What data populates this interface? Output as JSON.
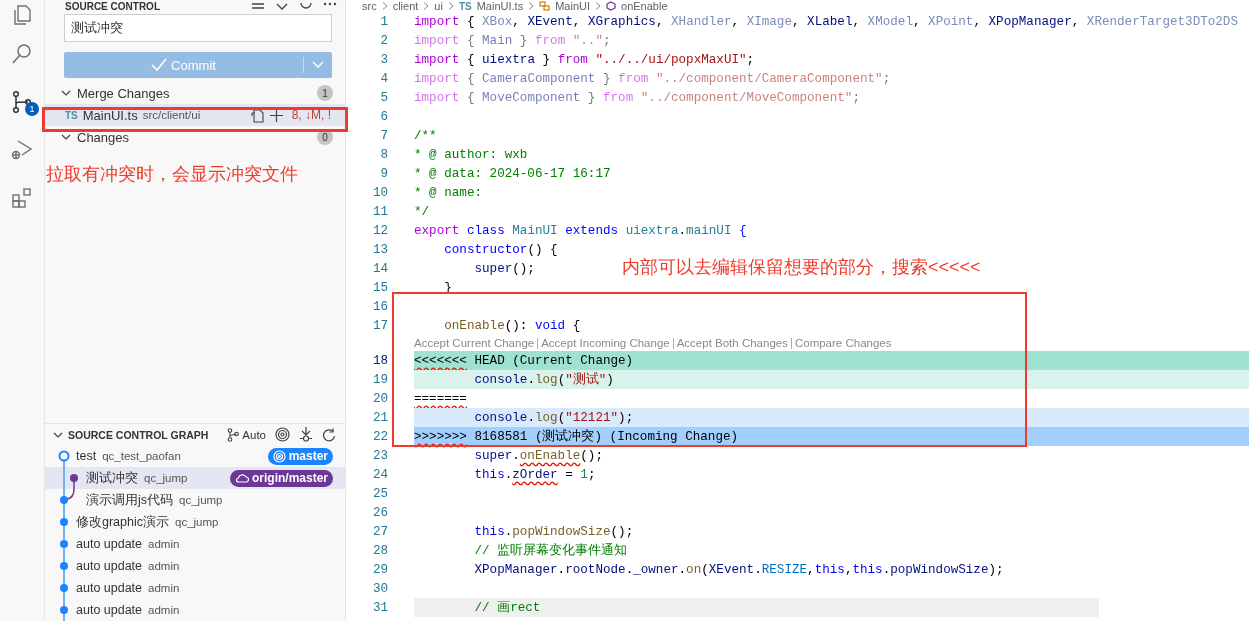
{
  "activity_bar": [
    {
      "kind": "explorer",
      "selected": false
    },
    {
      "kind": "search",
      "selected": false
    },
    {
      "kind": "source-control",
      "selected": true,
      "badge": "1"
    },
    {
      "kind": "run-debug",
      "selected": false
    },
    {
      "kind": "extensions",
      "selected": false
    }
  ],
  "sidebar": {
    "title": "SOURCE CONTROL",
    "commit_message": "测试冲突",
    "commit_button": "Commit",
    "groups": [
      {
        "label": "Merge Changes",
        "count": "1",
        "expanded": true,
        "files": [
          {
            "badge": "TS",
            "name": "MainUI.ts",
            "path": "src/client/ui",
            "status": "8, ↓M, !",
            "selected": true
          }
        ]
      },
      {
        "label": "Changes",
        "count": "0",
        "expanded": true
      }
    ],
    "note": "拉取有冲突时，会显示冲突文件",
    "graph": {
      "title": "SOURCE CONTROL GRAPH",
      "mode": "Auto",
      "commits": [
        {
          "kind": "head",
          "message": "test",
          "author": "qc_test_paofan",
          "selected": false,
          "ref": {
            "kind": "local",
            "label": "master"
          }
        },
        {
          "kind": "branch",
          "message": "测试冲突",
          "author": "qc_jump",
          "selected": true,
          "ref": {
            "kind": "remote",
            "label": "origin/master"
          }
        },
        {
          "kind": "join",
          "message": "演示调用js代码",
          "author": "qc_jump",
          "selected": false
        },
        {
          "kind": "commit",
          "message": "修改graphic演示",
          "author": "qc_jump",
          "selected": false
        },
        {
          "kind": "commit",
          "message": "auto update",
          "author": "admin",
          "selected": false
        },
        {
          "kind": "commit",
          "message": "auto update",
          "author": "admin",
          "selected": false
        },
        {
          "kind": "commit",
          "message": "auto update",
          "author": "admin",
          "selected": false
        },
        {
          "kind": "commit",
          "message": "auto update",
          "author": "admin",
          "selected": false
        }
      ]
    }
  },
  "editor": {
    "breadcrumb": {
      "folders": [
        "src",
        "client",
        "ui"
      ],
      "file_badge": "TS",
      "file": "MainUI.ts",
      "class": "MainUI",
      "method": "onEnable"
    },
    "codelens": [
      "Accept Current Change",
      "Accept Incoming Change",
      "Accept Both Changes",
      "Compare Changes"
    ],
    "note": "内部可以去编辑保留想要的部分，搜索<<<<<",
    "lines": [
      {
        "n": "1",
        "kind": "code",
        "tokens": [
          {
            "text": "import ",
            "kind": "kw"
          },
          {
            "text": "{ ",
            "kind": "p"
          },
          {
            "text": "XBox",
            "kind": "u"
          },
          {
            "text": ", ",
            "kind": "p"
          },
          {
            "text": "XEvent",
            "kind": "v"
          },
          {
            "text": ", ",
            "kind": "p"
          },
          {
            "text": "XGraphics",
            "kind": "v"
          },
          {
            "text": ", ",
            "kind": "p"
          },
          {
            "text": "XHandler",
            "kind": "u"
          },
          {
            "text": ", ",
            "kind": "p"
          },
          {
            "text": "XImage",
            "kind": "u"
          },
          {
            "text": ", ",
            "kind": "p"
          },
          {
            "text": "XLabel",
            "kind": "v"
          },
          {
            "text": ", ",
            "kind": "p"
          },
          {
            "text": "XModel",
            "kind": "u"
          },
          {
            "text": ", ",
            "kind": "p"
          },
          {
            "text": "XPoint",
            "kind": "u"
          },
          {
            "text": ", ",
            "kind": "p"
          },
          {
            "text": "XPopManager",
            "kind": "v"
          },
          {
            "text": ", ",
            "kind": "p"
          },
          {
            "text": "XRenderTarget3DTo2DS",
            "kind": "u"
          }
        ]
      },
      {
        "n": "2",
        "kind": "faded",
        "tokens": [
          {
            "text": "import ",
            "kind": "kw"
          },
          {
            "text": "{ ",
            "kind": "p"
          },
          {
            "text": "Main",
            "kind": "v"
          },
          {
            "text": " } ",
            "kind": "p"
          },
          {
            "text": "from ",
            "kind": "kw"
          },
          {
            "text": "\"..\"",
            "kind": "str"
          },
          {
            "text": ";",
            "kind": "p"
          }
        ]
      },
      {
        "n": "3",
        "kind": "code",
        "tokens": [
          {
            "text": "import ",
            "kind": "kw"
          },
          {
            "text": "{ ",
            "kind": "p"
          },
          {
            "text": "uiextra",
            "kind": "v"
          },
          {
            "text": " } ",
            "kind": "p"
          },
          {
            "text": "from ",
            "kind": "kw"
          },
          {
            "text": "\"../../ui/popxMaxUI\"",
            "kind": "str"
          },
          {
            "text": ";",
            "kind": "p"
          }
        ]
      },
      {
        "n": "4",
        "kind": "faded",
        "tokens": [
          {
            "text": "import ",
            "kind": "kw"
          },
          {
            "text": "{ ",
            "kind": "p"
          },
          {
            "text": "CameraComponent",
            "kind": "v"
          },
          {
            "text": " } ",
            "kind": "p"
          },
          {
            "text": "from ",
            "kind": "kw"
          },
          {
            "text": "\"../component/CameraComponent\"",
            "kind": "str"
          },
          {
            "text": ";",
            "kind": "p"
          }
        ]
      },
      {
        "n": "5",
        "kind": "faded",
        "tokens": [
          {
            "text": "import ",
            "kind": "kw"
          },
          {
            "text": "{ ",
            "kind": "p"
          },
          {
            "text": "MoveComponent",
            "kind": "v"
          },
          {
            "text": " } ",
            "kind": "p"
          },
          {
            "text": "from ",
            "kind": "kw"
          },
          {
            "text": "\"../component/MoveComponent\"",
            "kind": "str"
          },
          {
            "text": ";",
            "kind": "p"
          }
        ]
      },
      {
        "n": "6",
        "kind": "code"
      },
      {
        "n": "7",
        "kind": "code",
        "tokens": [
          {
            "text": "/**",
            "kind": "c"
          }
        ]
      },
      {
        "n": "8",
        "kind": "code",
        "tokens": [
          {
            "text": "* @ author: wxb",
            "kind": "c"
          }
        ]
      },
      {
        "n": "9",
        "kind": "code",
        "tokens": [
          {
            "text": "* @ data: 2024-06-17 16:17",
            "kind": "c"
          }
        ]
      },
      {
        "n": "10",
        "kind": "code",
        "tokens": [
          {
            "text": "* @ name:",
            "kind": "c"
          }
        ]
      },
      {
        "n": "11",
        "kind": "code",
        "tokens": [
          {
            "text": "*/",
            "kind": "c"
          }
        ]
      },
      {
        "n": "12",
        "kind": "code",
        "tokens": [
          {
            "text": "export ",
            "kind": "kw"
          },
          {
            "text": "class ",
            "kind": "st"
          },
          {
            "text": "MainUI ",
            "kind": "ty"
          },
          {
            "text": "extends ",
            "kind": "st"
          },
          {
            "text": "uiextra",
            "kind": "ty"
          },
          {
            "text": ".",
            "kind": "p"
          },
          {
            "text": "mainUI ",
            "kind": "ty"
          },
          {
            "text": "{",
            "kind": "st"
          }
        ]
      },
      {
        "n": "13",
        "kind": "code",
        "tokens": [
          {
            "text": "    constructor",
            "kind": "st"
          },
          {
            "text": "() {",
            "kind": "p"
          }
        ]
      },
      {
        "n": "14",
        "kind": "code",
        "tokens": [
          {
            "text": "        super",
            "kind": "v"
          },
          {
            "text": "();",
            "kind": "p"
          }
        ]
      },
      {
        "n": "15",
        "kind": "code",
        "tokens": [
          {
            "text": "    }",
            "kind": "p"
          }
        ]
      },
      {
        "n": "16",
        "kind": "code"
      },
      {
        "n": "17",
        "kind": "code",
        "tokens": [
          {
            "text": "    onEnable",
            "kind": "f"
          },
          {
            "text": "(): ",
            "kind": "p"
          },
          {
            "text": "void ",
            "kind": "st"
          },
          {
            "text": "{",
            "kind": "p"
          }
        ]
      },
      {
        "n": "18",
        "kind": "current-marker",
        "tokens": [
          {
            "text": "<<<<<<<",
            "kind": "err"
          },
          {
            "text": " HEAD (Current Change)",
            "kind": "p"
          }
        ]
      },
      {
        "n": "19",
        "kind": "current",
        "tokens": [
          {
            "text": "        console",
            "kind": "v"
          },
          {
            "text": ".",
            "kind": "p"
          },
          {
            "text": "log",
            "kind": "f"
          },
          {
            "text": "(",
            "kind": "p"
          },
          {
            "text": "\"测试\"",
            "kind": "str"
          },
          {
            "text": ")",
            "kind": "p"
          }
        ]
      },
      {
        "n": "20",
        "kind": "separator",
        "tokens": [
          {
            "text": "=======",
            "kind": "err"
          }
        ]
      },
      {
        "n": "21",
        "kind": "incoming",
        "tokens": [
          {
            "text": "        console",
            "kind": "v"
          },
          {
            "text": ".",
            "kind": "p"
          },
          {
            "text": "log",
            "kind": "f"
          },
          {
            "text": "(",
            "kind": "p"
          },
          {
            "text": "\"12121\"",
            "kind": "str"
          },
          {
            "text": ");",
            "kind": "p"
          }
        ]
      },
      {
        "n": "22",
        "kind": "incoming-marker",
        "tokens": [
          {
            "text": ">>>>>>>",
            "kind": "err"
          },
          {
            "text": " 8168581 (测试冲突) (Incoming Change)",
            "kind": "p"
          }
        ]
      },
      {
        "n": "23",
        "kind": "code",
        "tokens": [
          {
            "text": "        super",
            "kind": "v"
          },
          {
            "text": ".",
            "kind": "p"
          },
          {
            "text": "onEnable",
            "kind": "ferr"
          },
          {
            "text": "();",
            "kind": "p"
          }
        ]
      },
      {
        "n": "24",
        "kind": "code",
        "tokens": [
          {
            "text": "        this",
            "kind": "st"
          },
          {
            "text": ".",
            "kind": "p"
          },
          {
            "text": "zOrder",
            "kind": "verr"
          },
          {
            "text": " = ",
            "kind": "p"
          },
          {
            "text": "1",
            "kind": "n"
          },
          {
            "text": ";",
            "kind": "p"
          }
        ]
      },
      {
        "n": "25",
        "kind": "code"
      },
      {
        "n": "26",
        "kind": "code"
      },
      {
        "n": "27",
        "kind": "code",
        "tokens": [
          {
            "text": "        this",
            "kind": "st"
          },
          {
            "text": ".",
            "kind": "p"
          },
          {
            "text": "popWindowSize",
            "kind": "f"
          },
          {
            "text": "();",
            "kind": "p"
          }
        ]
      },
      {
        "n": "28",
        "kind": "code",
        "tokens": [
          {
            "text": "        // 监听屏幕变化事件通知",
            "kind": "c"
          }
        ]
      },
      {
        "n": "29",
        "kind": "code",
        "tokens": [
          {
            "text": "        XPopManager",
            "kind": "v"
          },
          {
            "text": ".",
            "kind": "p"
          },
          {
            "text": "rootNode",
            "kind": "v"
          },
          {
            "text": ".",
            "kind": "p"
          },
          {
            "text": "_owner",
            "kind": "v"
          },
          {
            "text": ".",
            "kind": "p"
          },
          {
            "text": "on",
            "kind": "f"
          },
          {
            "text": "(",
            "kind": "p"
          },
          {
            "text": "XEvent",
            "kind": "v"
          },
          {
            "text": ".",
            "kind": "p"
          },
          {
            "text": "RESIZE",
            "kind": "cst"
          },
          {
            "text": ",",
            "kind": "p"
          },
          {
            "text": "this",
            "kind": "st"
          },
          {
            "text": ",",
            "kind": "p"
          },
          {
            "text": "this",
            "kind": "st"
          },
          {
            "text": ".",
            "kind": "p"
          },
          {
            "text": "popWindowSize",
            "kind": "v"
          },
          {
            "text": ");",
            "kind": "p"
          }
        ]
      },
      {
        "n": "30",
        "kind": "code"
      },
      {
        "n": "31",
        "kind": "highlighted",
        "tokens": [
          {
            "text": "        // 画rect",
            "kind": "c"
          }
        ]
      }
    ]
  }
}
